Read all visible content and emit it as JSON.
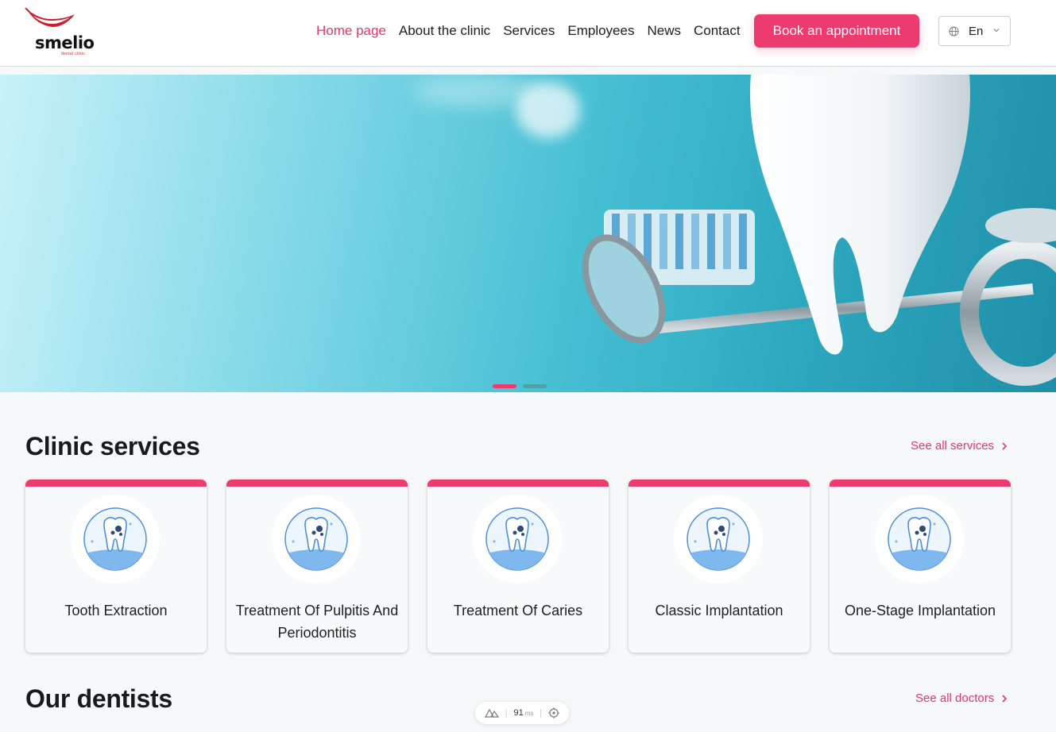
{
  "brand": {
    "name": "smelio",
    "tagline": "dental clinic",
    "logo_color": "#d01c2b"
  },
  "nav": {
    "items": [
      {
        "label": "Home page",
        "active": true
      },
      {
        "label": "About the clinic",
        "active": false
      },
      {
        "label": "Services",
        "active": false
      },
      {
        "label": "Employees",
        "active": false
      },
      {
        "label": "News",
        "active": false
      },
      {
        "label": "Contact",
        "active": false
      }
    ],
    "book_label": "Book an appointment",
    "language": {
      "value": "En",
      "icon": "globe-icon"
    }
  },
  "hero": {
    "slides_count": 2,
    "active_slide": 1,
    "dot_colors": {
      "active": "#ec3b6e",
      "inactive": "#4aa3a8"
    }
  },
  "services": {
    "title": "Clinic services",
    "see_all": "See all services",
    "items": [
      {
        "title": "Tooth Extraction",
        "icon": "tooth-icon"
      },
      {
        "title": "Treatment Of Pulpitis And Periodontitis",
        "icon": "tooth-icon"
      },
      {
        "title": "Treatment Of Caries",
        "icon": "tooth-icon"
      },
      {
        "title": "Classic Implantation",
        "icon": "tooth-icon"
      },
      {
        "title": "One-Stage Implantation",
        "icon": "tooth-icon"
      }
    ]
  },
  "dentists": {
    "title": "Our dentists",
    "see_all": "See all doctors"
  },
  "devtools": {
    "value": "91",
    "unit": "ms"
  },
  "colors": {
    "accent": "#ec3b6e",
    "text": "#1f1f1f",
    "page_bg": "#f7f8fa"
  }
}
